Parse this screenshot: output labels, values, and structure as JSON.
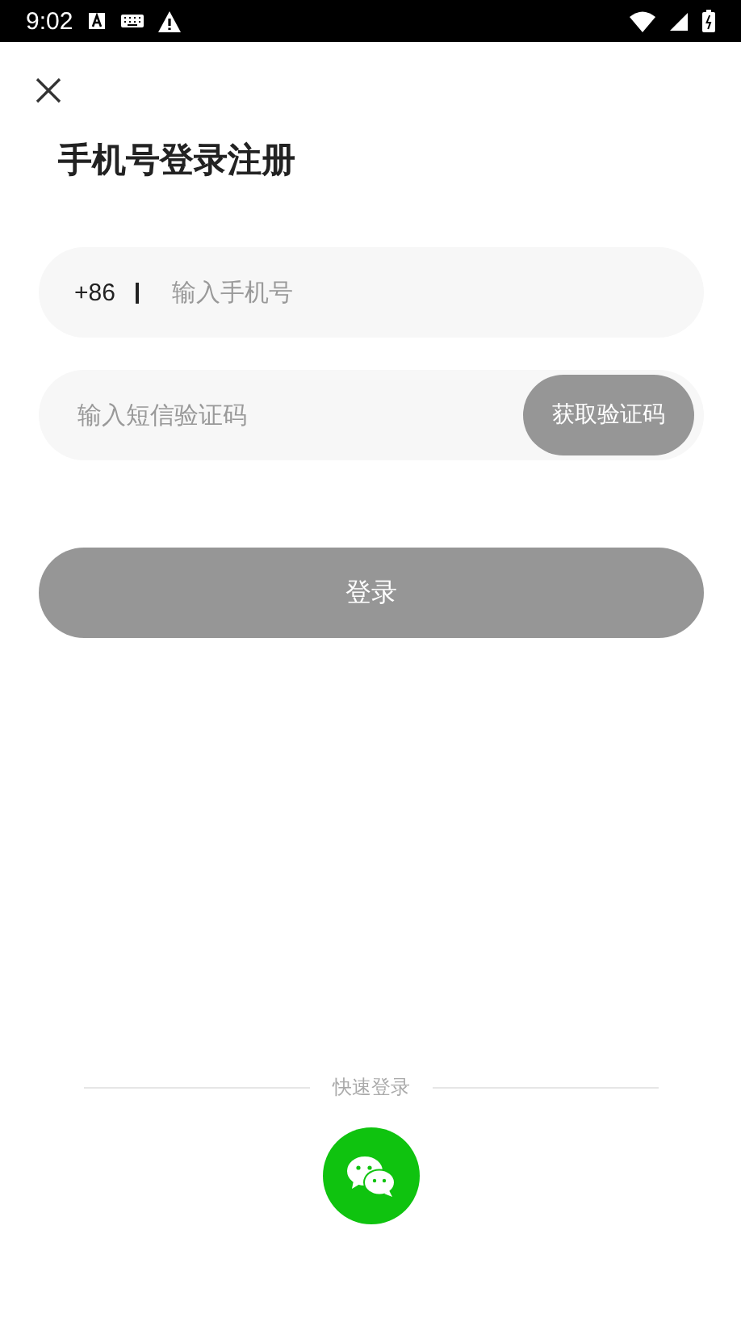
{
  "status_bar": {
    "time": "9:02"
  },
  "title": "手机号登录注册",
  "phone_field": {
    "prefix": "+86",
    "placeholder": "输入手机号"
  },
  "code_field": {
    "placeholder": "输入短信验证码",
    "button": {
      "label": "获取验证码",
      "disabled": true
    }
  },
  "login_button": {
    "label": "登录",
    "disabled": true
  },
  "quick_login": {
    "label": "快速登录"
  }
}
